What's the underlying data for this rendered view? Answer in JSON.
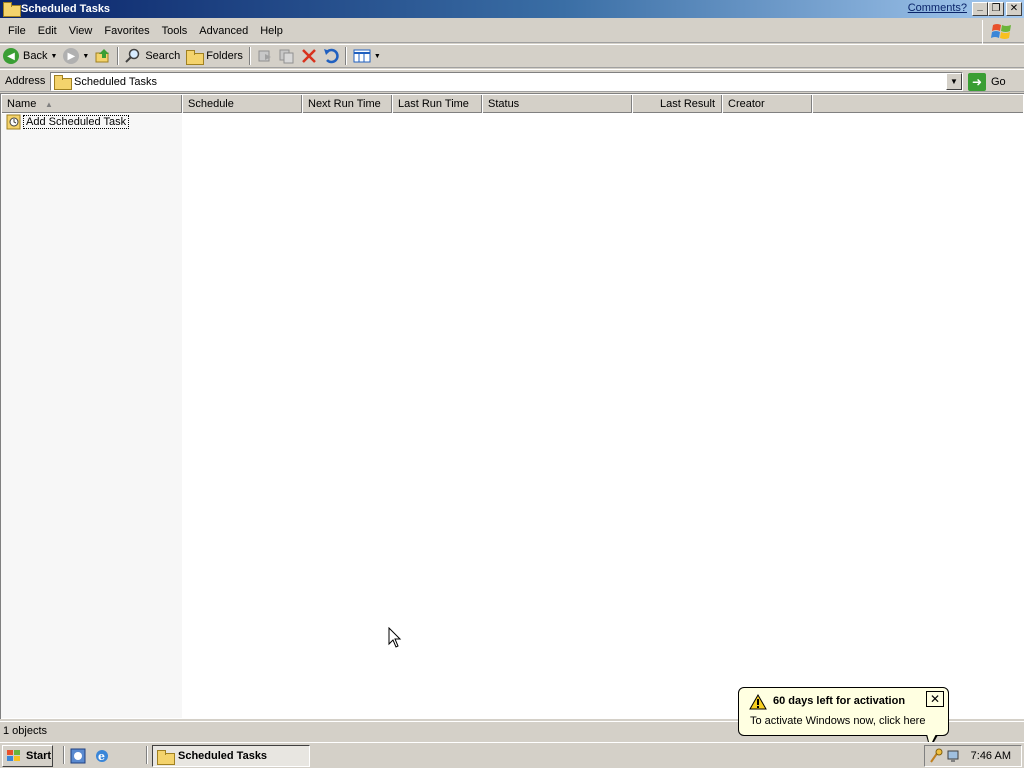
{
  "window": {
    "title": "Scheduled Tasks",
    "comments_link": "Comments?",
    "buttons": {
      "minimize": "_",
      "restore": "❐",
      "close": "✕"
    }
  },
  "menu": {
    "items": [
      "File",
      "Edit",
      "View",
      "Favorites",
      "Tools",
      "Advanced",
      "Help"
    ]
  },
  "toolbar": {
    "back_label": "Back",
    "search_label": "Search",
    "folders_label": "Folders"
  },
  "address": {
    "label": "Address",
    "value": "Scheduled Tasks",
    "go_label": "Go"
  },
  "list": {
    "columns": [
      "Name",
      "Schedule",
      "Next Run Time",
      "Last Run Time",
      "Status",
      "Last Result",
      "Creator"
    ],
    "sorted_by": "Name",
    "rows": [
      {
        "name": "Add Scheduled Task"
      }
    ]
  },
  "statusbar": {
    "text": "1 objects"
  },
  "taskbar": {
    "start_label": "Start",
    "task_item": "Scheduled Tasks",
    "clock": "7:46 AM"
  },
  "balloon": {
    "title": "60 days left for activation",
    "body": "To activate Windows now, click here",
    "close": "✕"
  },
  "colors": {
    "titlebar_start": "#0a246a",
    "titlebar_end": "#a6caf0",
    "face": "#d4d0c8",
    "balloon_bg": "#ffffe1"
  }
}
